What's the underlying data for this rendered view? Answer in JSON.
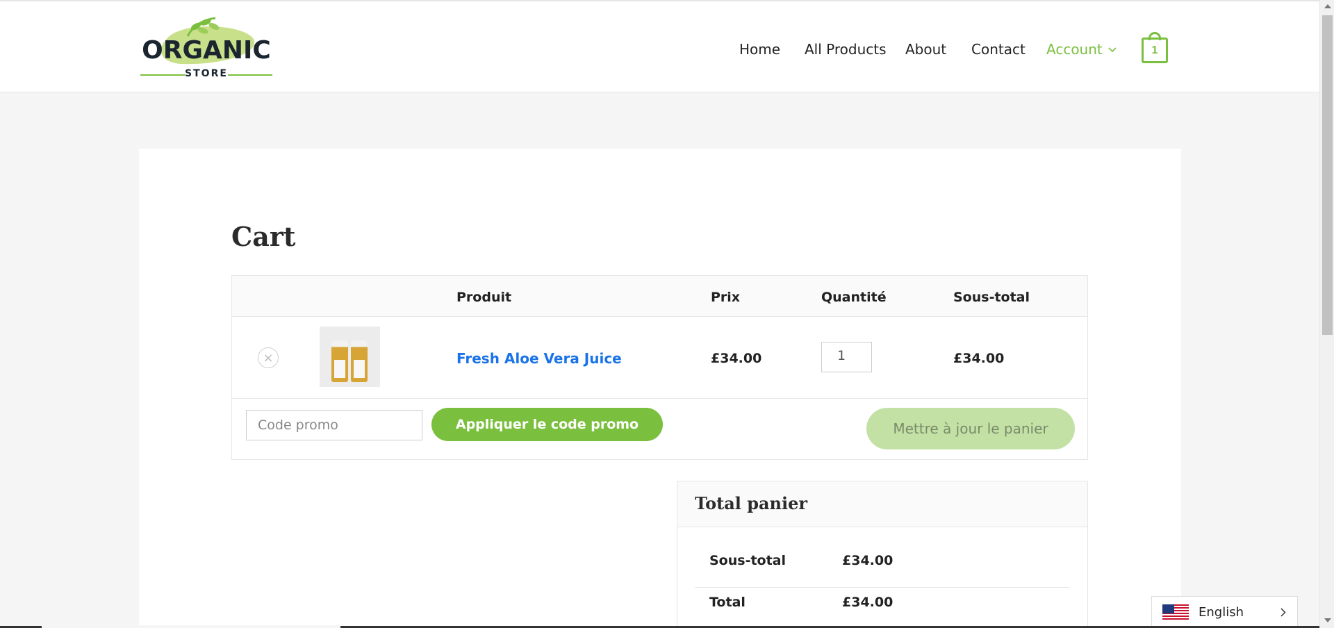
{
  "header": {
    "logo_text_top": "ORGANIC",
    "logo_text_bottom": "STORE",
    "nav": {
      "home": "Home",
      "all_products": "All Products",
      "about": "About",
      "contact": "Contact",
      "account": "Account"
    },
    "cart_count": "1"
  },
  "page": {
    "title": "Cart"
  },
  "cart_table": {
    "headers": {
      "product": "Produit",
      "price": "Prix",
      "quantity": "Quantité",
      "subtotal": "Sous-total"
    },
    "items": [
      {
        "remove": "×",
        "name": "Fresh Aloe Vera Juice",
        "price": "£34.00",
        "quantity": "1",
        "subtotal": "£34.00"
      }
    ],
    "promo_placeholder": "Code promo",
    "apply_promo_label": "Appliquer le code promo",
    "update_cart_label": "Mettre à jour le panier"
  },
  "totals": {
    "title": "Total panier",
    "subtotal_label": "Sous-total",
    "subtotal_value": "£34.00",
    "total_label": "Total",
    "total_value": "£34.00"
  },
  "language": {
    "current": "English"
  },
  "colors": {
    "accent": "#7bbf3f",
    "accent_light": "#c3e1a5",
    "link": "#1a73e8"
  }
}
